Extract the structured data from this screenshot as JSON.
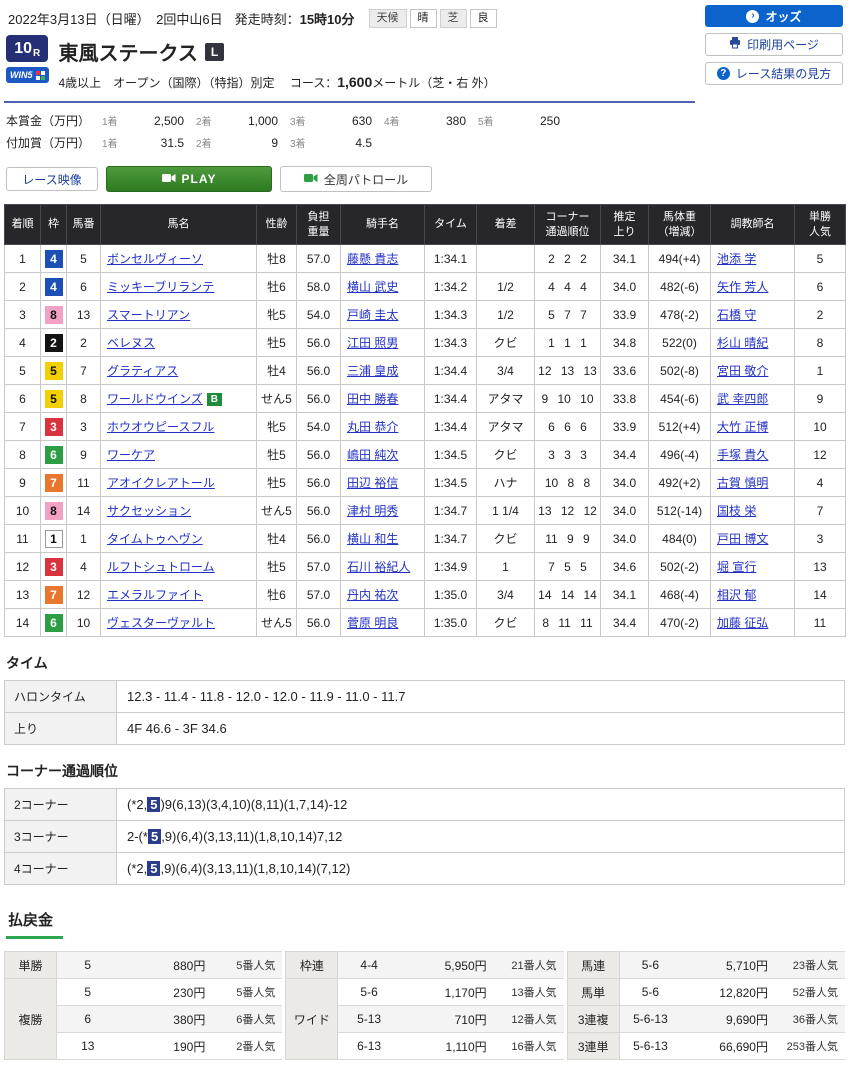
{
  "top": {
    "date_line": "2022年3月13日（日曜）　2回中山6日",
    "start_label": "発走時刻：",
    "start_time": "15時10分",
    "weather_label": "天候",
    "weather_value": "晴",
    "turf_label": "芝",
    "turf_value": "良",
    "odds_button": "オッズ",
    "print_button": "印刷用ページ",
    "guide_button": "レース結果の見方"
  },
  "race": {
    "number": "10",
    "number_suffix": "R",
    "win5": "WIN5",
    "title": "東風ステークス",
    "grade": "L",
    "conditions": "4歳以上　オープン（国際）（特指）別定",
    "course_label": "コース：",
    "course_distance": "1,600",
    "course_suffix": "メートル（芝・右 外）"
  },
  "prizes": {
    "main_label": "本賞金（万円）",
    "main": [
      {
        "rank": "1着",
        "amount": "2,500"
      },
      {
        "rank": "2着",
        "amount": "1,000"
      },
      {
        "rank": "3着",
        "amount": "630"
      },
      {
        "rank": "4着",
        "amount": "380"
      },
      {
        "rank": "5着",
        "amount": "250"
      }
    ],
    "added_label": "付加賞（万円）",
    "added": [
      {
        "rank": "1着",
        "amount": "31.5"
      },
      {
        "rank": "2着",
        "amount": "9"
      },
      {
        "rank": "3着",
        "amount": "4.5"
      }
    ]
  },
  "toolbar": {
    "video_button": "レース映像",
    "play_button": "PLAY",
    "patrol_button": "全周パトロール"
  },
  "results": {
    "headers": [
      "着順",
      "枠",
      "馬番",
      "馬名",
      "性齢",
      "負担\n重量",
      "騎手名",
      "タイム",
      "着差",
      "コーナー\n通過順位",
      "推定\n上り",
      "馬体重\n（増減）",
      "調教師名",
      "単勝\n人気"
    ],
    "rows": [
      {
        "pos": "1",
        "frame": "4",
        "num": "5",
        "horse": "ボンセルヴィーソ",
        "blinker": "",
        "sexage": "牡8",
        "weight": "57.0",
        "jockey": "藤懸 貴志",
        "time": "1:34.1",
        "margin": "",
        "corners": "2 2 2",
        "last3f": "34.1",
        "bodyweight": "494(+4)",
        "trainer": "池添 学",
        "odds_rank": "5"
      },
      {
        "pos": "2",
        "frame": "4",
        "num": "6",
        "horse": "ミッキーブリランテ",
        "blinker": "",
        "sexage": "牡6",
        "weight": "58.0",
        "jockey": "横山 武史",
        "time": "1:34.2",
        "margin": "1/2",
        "corners": "4 4 4",
        "last3f": "34.0",
        "bodyweight": "482(-6)",
        "trainer": "矢作 芳人",
        "odds_rank": "6"
      },
      {
        "pos": "3",
        "frame": "8",
        "num": "13",
        "horse": "スマートリアン",
        "blinker": "",
        "sexage": "牝5",
        "weight": "54.0",
        "jockey": "戸崎 圭太",
        "time": "1:34.3",
        "margin": "1/2",
        "corners": "5 7 7",
        "last3f": "33.9",
        "bodyweight": "478(-2)",
        "trainer": "石橋 守",
        "odds_rank": "2"
      },
      {
        "pos": "4",
        "frame": "2",
        "num": "2",
        "horse": "ベレヌス",
        "blinker": "",
        "sexage": "牡5",
        "weight": "56.0",
        "jockey": "江田 照男",
        "time": "1:34.3",
        "margin": "クビ",
        "corners": "1 1 1",
        "last3f": "34.8",
        "bodyweight": "522(0)",
        "trainer": "杉山 晴紀",
        "odds_rank": "8"
      },
      {
        "pos": "5",
        "frame": "5",
        "num": "7",
        "horse": "グラティアス",
        "blinker": "",
        "sexage": "牡4",
        "weight": "56.0",
        "jockey": "三浦 皇成",
        "time": "1:34.4",
        "margin": "3/4",
        "corners": "12 13 13",
        "last3f": "33.6",
        "bodyweight": "502(-8)",
        "trainer": "宮田 敬介",
        "odds_rank": "1"
      },
      {
        "pos": "6",
        "frame": "5",
        "num": "8",
        "horse": "ワールドウインズ",
        "blinker": "B",
        "sexage": "せん5",
        "weight": "56.0",
        "jockey": "田中 勝春",
        "time": "1:34.4",
        "margin": "アタマ",
        "corners": "9 10 10",
        "last3f": "33.8",
        "bodyweight": "454(-6)",
        "trainer": "武 幸四郎",
        "odds_rank": "9"
      },
      {
        "pos": "7",
        "frame": "3",
        "num": "3",
        "horse": "ホウオウピースフル",
        "blinker": "",
        "sexage": "牝5",
        "weight": "54.0",
        "jockey": "丸田 恭介",
        "time": "1:34.4",
        "margin": "アタマ",
        "corners": "6 6 6",
        "last3f": "33.9",
        "bodyweight": "512(+4)",
        "trainer": "大竹 正博",
        "odds_rank": "10"
      },
      {
        "pos": "8",
        "frame": "6",
        "num": "9",
        "horse": "ワーケア",
        "blinker": "",
        "sexage": "牡5",
        "weight": "56.0",
        "jockey": "嶋田 純次",
        "time": "1:34.5",
        "margin": "クビ",
        "corners": "3 3 3",
        "last3f": "34.4",
        "bodyweight": "496(-4)",
        "trainer": "手塚 貴久",
        "odds_rank": "12"
      },
      {
        "pos": "9",
        "frame": "7",
        "num": "11",
        "horse": "アオイクレアトール",
        "blinker": "",
        "sexage": "牡5",
        "weight": "56.0",
        "jockey": "田辺 裕信",
        "time": "1:34.5",
        "margin": "ハナ",
        "corners": "10 8 8",
        "last3f": "34.0",
        "bodyweight": "492(+2)",
        "trainer": "古賀 慎明",
        "odds_rank": "4"
      },
      {
        "pos": "10",
        "frame": "8",
        "num": "14",
        "horse": "サクセッション",
        "blinker": "",
        "sexage": "せん5",
        "weight": "56.0",
        "jockey": "津村 明秀",
        "time": "1:34.7",
        "margin": "1 1/4",
        "corners": "13 12 12",
        "last3f": "34.0",
        "bodyweight": "512(-14)",
        "trainer": "国枝 栄",
        "odds_rank": "7"
      },
      {
        "pos": "11",
        "frame": "1",
        "num": "1",
        "horse": "タイムトゥヘヴン",
        "blinker": "",
        "sexage": "牡4",
        "weight": "56.0",
        "jockey": "横山 和生",
        "time": "1:34.7",
        "margin": "クビ",
        "corners": "11 9 9",
        "last3f": "34.0",
        "bodyweight": "484(0)",
        "trainer": "戸田 博文",
        "odds_rank": "3"
      },
      {
        "pos": "12",
        "frame": "3",
        "num": "4",
        "horse": "ルフトシュトローム",
        "blinker": "",
        "sexage": "牡5",
        "weight": "57.0",
        "jockey": "石川 裕紀人",
        "time": "1:34.9",
        "margin": "1",
        "corners": "7 5 5",
        "last3f": "34.6",
        "bodyweight": "502(-2)",
        "trainer": "堀 宣行",
        "odds_rank": "13"
      },
      {
        "pos": "13",
        "frame": "7",
        "num": "12",
        "horse": "エメラルファイト",
        "blinker": "",
        "sexage": "牡6",
        "weight": "57.0",
        "jockey": "丹内 祐次",
        "time": "1:35.0",
        "margin": "3/4",
        "corners": "14 14 14",
        "last3f": "34.1",
        "bodyweight": "468(-4)",
        "trainer": "相沢 郁",
        "odds_rank": "14"
      },
      {
        "pos": "14",
        "frame": "6",
        "num": "10",
        "horse": "ヴェスターヴァルト",
        "blinker": "",
        "sexage": "せん5",
        "weight": "56.0",
        "jockey": "菅原 明良",
        "time": "1:35.0",
        "margin": "クビ",
        "corners": "8 11 11",
        "last3f": "34.4",
        "bodyweight": "470(-2)",
        "trainer": "加藤 征弘",
        "odds_rank": "11"
      }
    ]
  },
  "time_section": {
    "title": "タイム",
    "rows": [
      {
        "label": "ハロンタイム",
        "value": "12.3 - 11.4 - 11.8 - 12.0 - 12.0 - 11.9 - 11.0 - 11.7"
      },
      {
        "label": "上り",
        "value": "4F 46.6 - 3F 34.6"
      }
    ]
  },
  "corner_section": {
    "title": "コーナー通過順位",
    "rows": [
      {
        "label": "2コーナー",
        "pre": "(*2,",
        "mark": "5",
        "post": ")9(6,13)(3,4,10)(8,11)(1,7,14)-12"
      },
      {
        "label": "3コーナー",
        "pre": "2-(*",
        "mark": "5",
        "post": ",9)(6,4)(3,13,11)(1,8,10,14)7,12"
      },
      {
        "label": "4コーナー",
        "pre": "(*2,",
        "mark": "5",
        "post": ",9)(6,4)(3,13,11)(1,8,10,14)(7,12)"
      }
    ]
  },
  "payouts": {
    "title": "払戻金",
    "tansho_label": "単勝",
    "tansho": {
      "num": "5",
      "yen": "880円",
      "pop": "5番人気"
    },
    "fukusho_label": "複勝",
    "fukusho": [
      {
        "num": "5",
        "yen": "230円",
        "pop": "5番人気"
      },
      {
        "num": "6",
        "yen": "380円",
        "pop": "6番人気"
      },
      {
        "num": "13",
        "yen": "190円",
        "pop": "2番人気"
      }
    ],
    "wakuren_label": "枠連",
    "wakuren": {
      "num": "4-4",
      "yen": "5,950円",
      "pop": "21番人気"
    },
    "wide_label": "ワイド",
    "wide": [
      {
        "num": "5-6",
        "yen": "1,170円",
        "pop": "13番人気"
      },
      {
        "num": "5-13",
        "yen": "710円",
        "pop": "12番人気"
      },
      {
        "num": "6-13",
        "yen": "1,110円",
        "pop": "16番人気"
      }
    ],
    "umaren_label": "馬連",
    "umaren": {
      "num": "5-6",
      "yen": "5,710円",
      "pop": "23番人気"
    },
    "umatan_label": "馬単",
    "umatan": {
      "num": "5-6",
      "yen": "12,820円",
      "pop": "52番人気"
    },
    "sanrenpuku_label": "3連複",
    "sanrenpuku": {
      "num": "5-6-13",
      "yen": "9,690円",
      "pop": "36番人気"
    },
    "sanrentan_label": "3連単",
    "sanrentan": {
      "num": "5-6-13",
      "yen": "66,690円",
      "pop": "253番人気"
    }
  }
}
